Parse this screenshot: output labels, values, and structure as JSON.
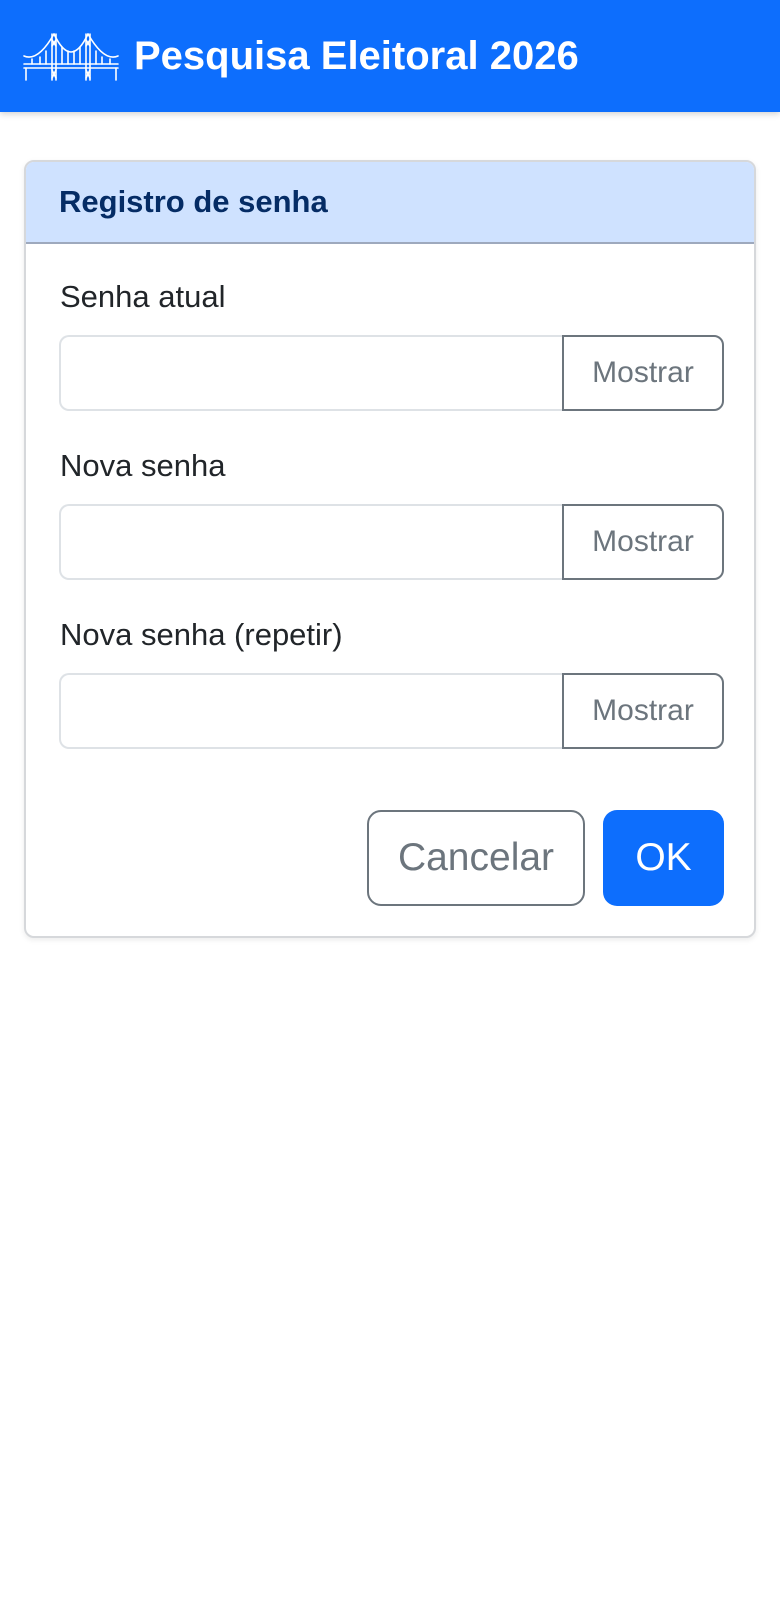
{
  "app": {
    "title": "Pesquisa Eleitoral 2026",
    "logo_icon": "bridge-logo-icon",
    "brand_color": "#0d6efd"
  },
  "dialog": {
    "title": "Registro de senha",
    "header_color": "#cfe2ff",
    "fields": [
      {
        "label": "Senha atual",
        "value": "",
        "placeholder": "",
        "toggle_label": "Mostrar"
      },
      {
        "label": "Nova senha",
        "value": "",
        "placeholder": "",
        "toggle_label": "Mostrar"
      },
      {
        "label": "Nova senha (repetir)",
        "value": "",
        "placeholder": "",
        "toggle_label": "Mostrar"
      }
    ],
    "cancel_label": "Cancelar",
    "ok_label": "OK"
  }
}
